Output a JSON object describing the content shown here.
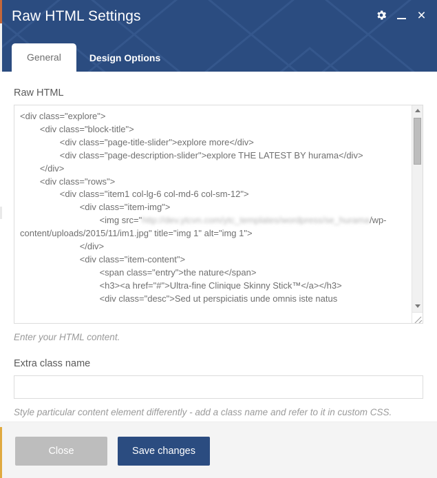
{
  "window": {
    "title": "Raw HTML Settings",
    "accent_color": "#2b4c80",
    "edge_accent_color": "#c4673a",
    "controls": {
      "settings_label": "⚙",
      "minimize_label": "",
      "close_label": "×"
    }
  },
  "tabs": [
    {
      "label": "General",
      "active": true
    },
    {
      "label": "Design Options",
      "active": false
    }
  ],
  "main": {
    "raw_html": {
      "label": "Raw HTML",
      "value_before_blur": "<div class=\"explore\">\n        <div class=\"block-title\">\n                <div class=\"page-title-slider\">explore more</div>\n                <div class=\"page-description-slider\">explore THE LATEST BY hurama</div>\n        </div>\n        <div class=\"rows\">\n                <div class=\"item1 col-lg-6 col-md-6 col-sm-12\">\n                        <div class=\"item-img\">\n                                <img src=\"",
      "blurred_url": "http://dev.ytcvn.com/ytc_templates/wordpress/se_hurama",
      "value_after_blur": "/wp-content/uploads/2015/11/im1.jpg\" title=\"img 1\" alt=\"img 1\">\n                        </div>\n                        <div class=\"item-content\">\n                                <span class=\"entry\">the nature</span>\n                                <h3><a href=\"#\">Ultra-fine Clinique Skinny Stick™</a></h3>\n                                <div class=\"desc\">Sed ut perspiciatis unde omnis iste natus",
      "help_text": "Enter your HTML content.",
      "scrollbar": {
        "up_arrow": "▲",
        "down_arrow": "▼"
      }
    },
    "extra_class": {
      "label": "Extra class name",
      "value": "",
      "placeholder": "",
      "help_text": "Style particular content element differently - add a class name and refer to it in custom CSS."
    }
  },
  "footer": {
    "close_label": "Close",
    "save_label": "Save changes"
  }
}
